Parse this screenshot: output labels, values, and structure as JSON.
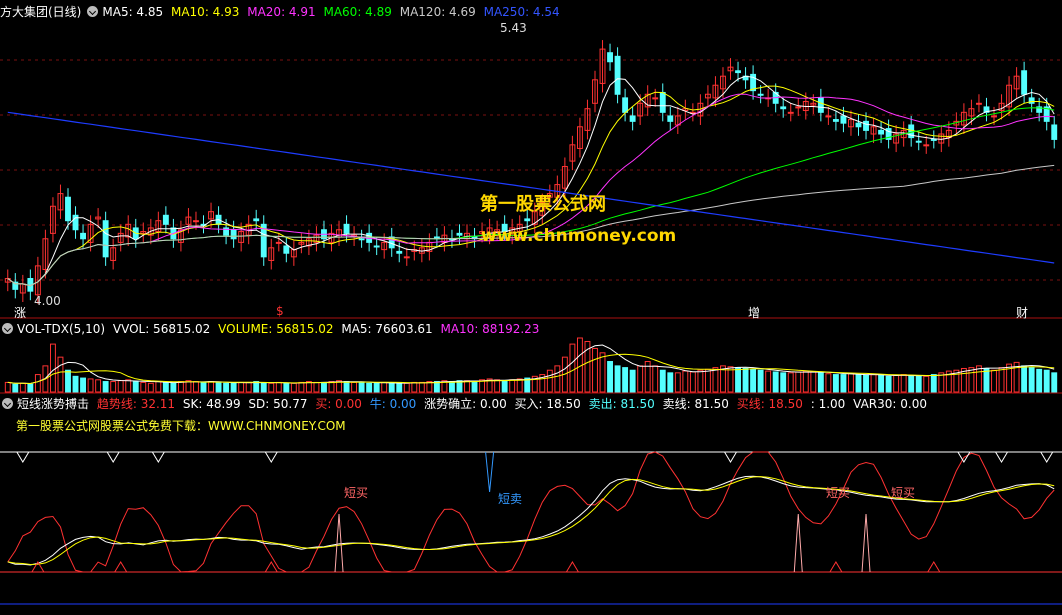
{
  "header": {
    "stock_name": "方大集团(日线)",
    "ma5": "MA5: 4.85",
    "ma10": "MA10: 4.93",
    "ma20": "MA20: 4.91",
    "ma60": "MA60: 4.89",
    "ma120": "MA120: 4.69",
    "ma250": "MA250: 4.54"
  },
  "price_labels": {
    "high": "5.43",
    "low": "4.00"
  },
  "watermark": {
    "line1": "第一股票公式网",
    "line2": "www.chnmoney.com"
  },
  "date_markers": [
    "涨",
    "$",
    "增",
    "财"
  ],
  "volume_header": {
    "name": "VOL-TDX(5,10)",
    "vvol": "VVOL: 56815.02",
    "volume": "VOLUME: 56815.02",
    "ma5": "MA5: 76603.61",
    "ma10": "MA10: 88192.23"
  },
  "indicator_header": {
    "name": "短线涨势搏击",
    "trend": "趋势线: 32.11",
    "sk": "SK: 48.99",
    "sd": "SD: 50.77",
    "buy": "买: 0.00",
    "cow": "牛: 0.00",
    "confirm": "涨势确立: 0.00",
    "buy_in": "买入: 18.50",
    "sell_out": "卖出: 81.50",
    "sell_line": "卖线: 81.50",
    "buy_line": "买线: 18.50",
    "one": ": 1.00",
    "var30": "VAR30: 0.00"
  },
  "indicator_subtitle": "第一股票公式网股票公式免费下载：WWW.CHNMONEY.COM",
  "signals": {
    "short_buy": "短买",
    "short_sell": "短卖"
  },
  "colors": {
    "up": "#ff3232",
    "down": "#54ffff",
    "ma5": "#ffffff",
    "ma10": "#ffff00",
    "ma20": "#ff33ff",
    "ma60": "#00ff00",
    "ma120": "#c8c8c8",
    "ma250": "#1e3cff"
  },
  "chart_data": {
    "type": "candlestick",
    "price": [
      4.08,
      4.02,
      4.05,
      4.01,
      4.15,
      4.3,
      4.48,
      4.55,
      4.4,
      4.35,
      4.3,
      4.38,
      4.42,
      4.2,
      4.25,
      4.33,
      4.38,
      4.3,
      4.34,
      4.36,
      4.4,
      4.38,
      4.3,
      4.35,
      4.42,
      4.4,
      4.38,
      4.45,
      4.38,
      4.32,
      4.3,
      4.34,
      4.38,
      4.4,
      4.2,
      4.25,
      4.28,
      4.22,
      4.24,
      4.28,
      4.3,
      4.32,
      4.3,
      4.33,
      4.35,
      4.33,
      4.32,
      4.3,
      4.28,
      4.26,
      4.28,
      4.25,
      4.22,
      4.2,
      4.24,
      4.25,
      4.28,
      4.3,
      4.32,
      4.3,
      4.32,
      4.33,
      4.3,
      4.34,
      4.36,
      4.35,
      4.34,
      4.36,
      4.38,
      4.4,
      4.45,
      4.5,
      4.55,
      4.6,
      4.7,
      4.82,
      4.92,
      5.02,
      5.18,
      5.35,
      5.28,
      5.1,
      5.0,
      4.95,
      5.05,
      5.1,
      5.08,
      5.0,
      4.95,
      4.98,
      5.02,
      5.0,
      5.05,
      5.1,
      5.15,
      5.2,
      5.25,
      5.22,
      5.18,
      5.12,
      5.1,
      5.08,
      5.05,
      5.02,
      5.0,
      5.03,
      5.06,
      5.05,
      5.0,
      4.98,
      4.95,
      4.94,
      4.96,
      4.92,
      4.9,
      4.92,
      4.88,
      4.85,
      4.88,
      4.9,
      4.86,
      4.84,
      4.82,
      4.85,
      4.88,
      4.9,
      4.95,
      5.0,
      5.02,
      5.05,
      5.0,
      4.98,
      5.05,
      5.15,
      5.2,
      5.1,
      5.05,
      5.0,
      4.95,
      4.85
    ],
    "volume": [
      11,
      9,
      10,
      9,
      20,
      30,
      55,
      40,
      25,
      18,
      16,
      15,
      14,
      12,
      12,
      13,
      14,
      12,
      11,
      10,
      12,
      11,
      10,
      12,
      13,
      12,
      11,
      12,
      11,
      10,
      10,
      11,
      11,
      12,
      10,
      10,
      11,
      10,
      10,
      11,
      12,
      11,
      11,
      12,
      13,
      12,
      11,
      11,
      10,
      10,
      11,
      10,
      10,
      10,
      11,
      11,
      12,
      12,
      13,
      12,
      13,
      13,
      12,
      14,
      15,
      14,
      13,
      14,
      15,
      16,
      18,
      20,
      25,
      30,
      40,
      55,
      62,
      58,
      50,
      45,
      35,
      30,
      28,
      25,
      30,
      35,
      30,
      25,
      22,
      22,
      24,
      23,
      25,
      26,
      28,
      30,
      29,
      28,
      27,
      26,
      25,
      24,
      23,
      22,
      22,
      23,
      24,
      23,
      22,
      21,
      20,
      20,
      21,
      20,
      19,
      20,
      19,
      18,
      19,
      20,
      19,
      18,
      18,
      20,
      22,
      24,
      25,
      27,
      28,
      30,
      27,
      25,
      28,
      32,
      34,
      30,
      28,
      26,
      25,
      22
    ],
    "ylim": [
      3.95,
      5.5
    ]
  }
}
